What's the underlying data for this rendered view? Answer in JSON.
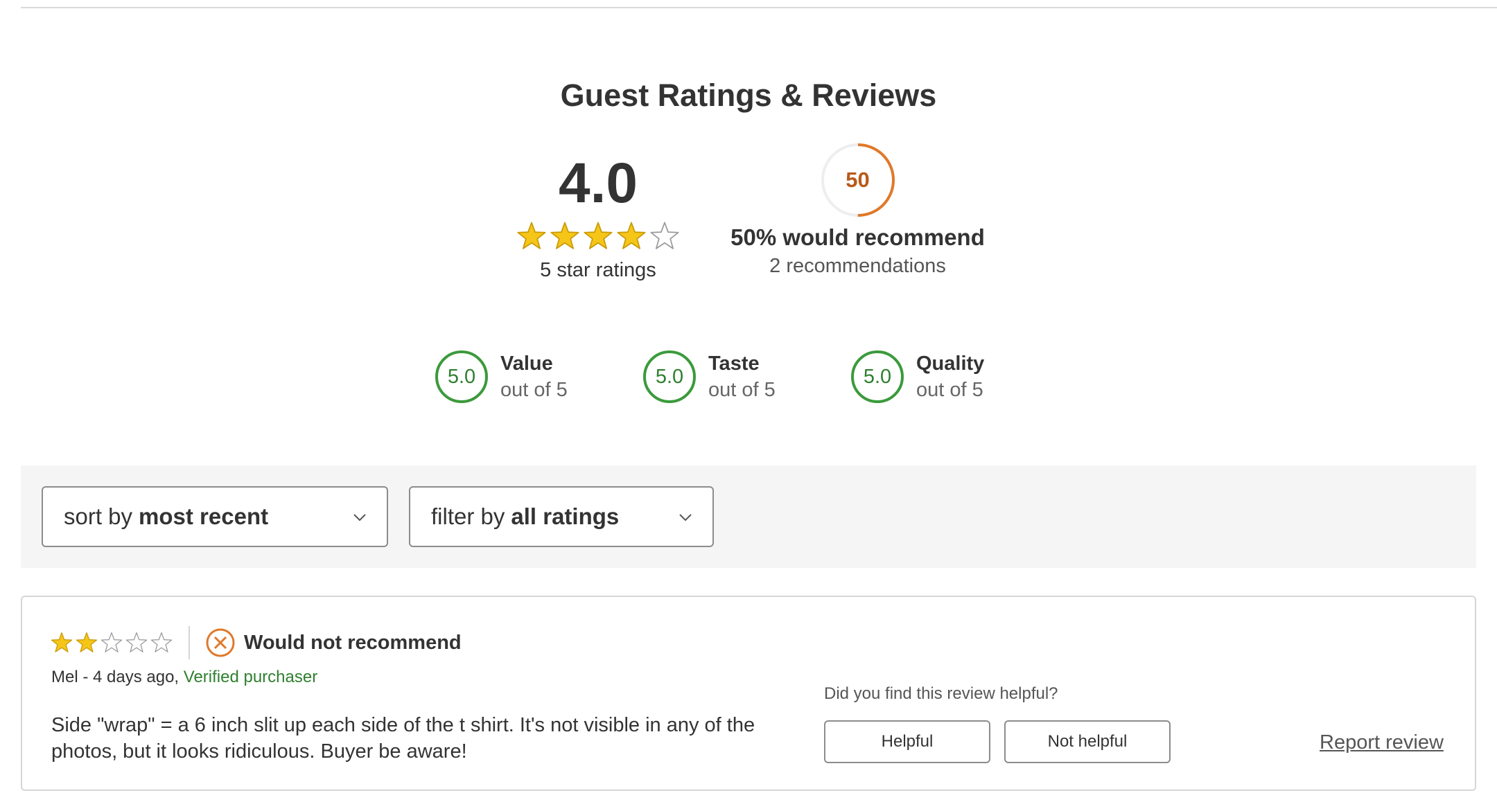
{
  "header": {
    "title": "Guest Ratings & Reviews"
  },
  "overall": {
    "score": "4.0",
    "rating_value": 4,
    "max_stars": 5,
    "count_label": "5 star ratings"
  },
  "recommend": {
    "percent_value": 50,
    "ring_label": "50",
    "headline": "50% would recommend",
    "sub": "2 recommendations",
    "ring_color": "#e0792a"
  },
  "subratings": [
    {
      "score": "5.0",
      "name": "Value",
      "of": "out of 5"
    },
    {
      "score": "5.0",
      "name": "Taste",
      "of": "out of 5"
    },
    {
      "score": "5.0",
      "name": "Quality",
      "of": "out of 5"
    }
  ],
  "toolbar": {
    "sort_prefix": "sort by",
    "sort_value": "most recent",
    "filter_prefix": "filter by",
    "filter_value": "all ratings"
  },
  "review": {
    "rating_value": 2,
    "max_stars": 5,
    "recommend_label": "Would not recommend",
    "author_meta": "Mel - 4 days ago,",
    "verified": "Verified purchaser",
    "body": "Side \"wrap\" = a 6 inch slit up each side of the t shirt. It's not visible in any of the photos, but it looks ridiculous. Buyer be aware!",
    "helpful_question": "Did you find this review helpful?",
    "helpful_label": "Helpful",
    "not_helpful_label": "Not helpful",
    "report_label": "Report review"
  },
  "colors": {
    "star_fill": "#f5c518",
    "star_stroke": "#c99a06",
    "star_empty_stroke": "#999999",
    "green": "#3b9a3b",
    "orange": "#e0792a"
  },
  "icons": {
    "star": "star-icon",
    "chevron": "chevron-down-icon",
    "not_recommend": "x-circle-icon"
  }
}
